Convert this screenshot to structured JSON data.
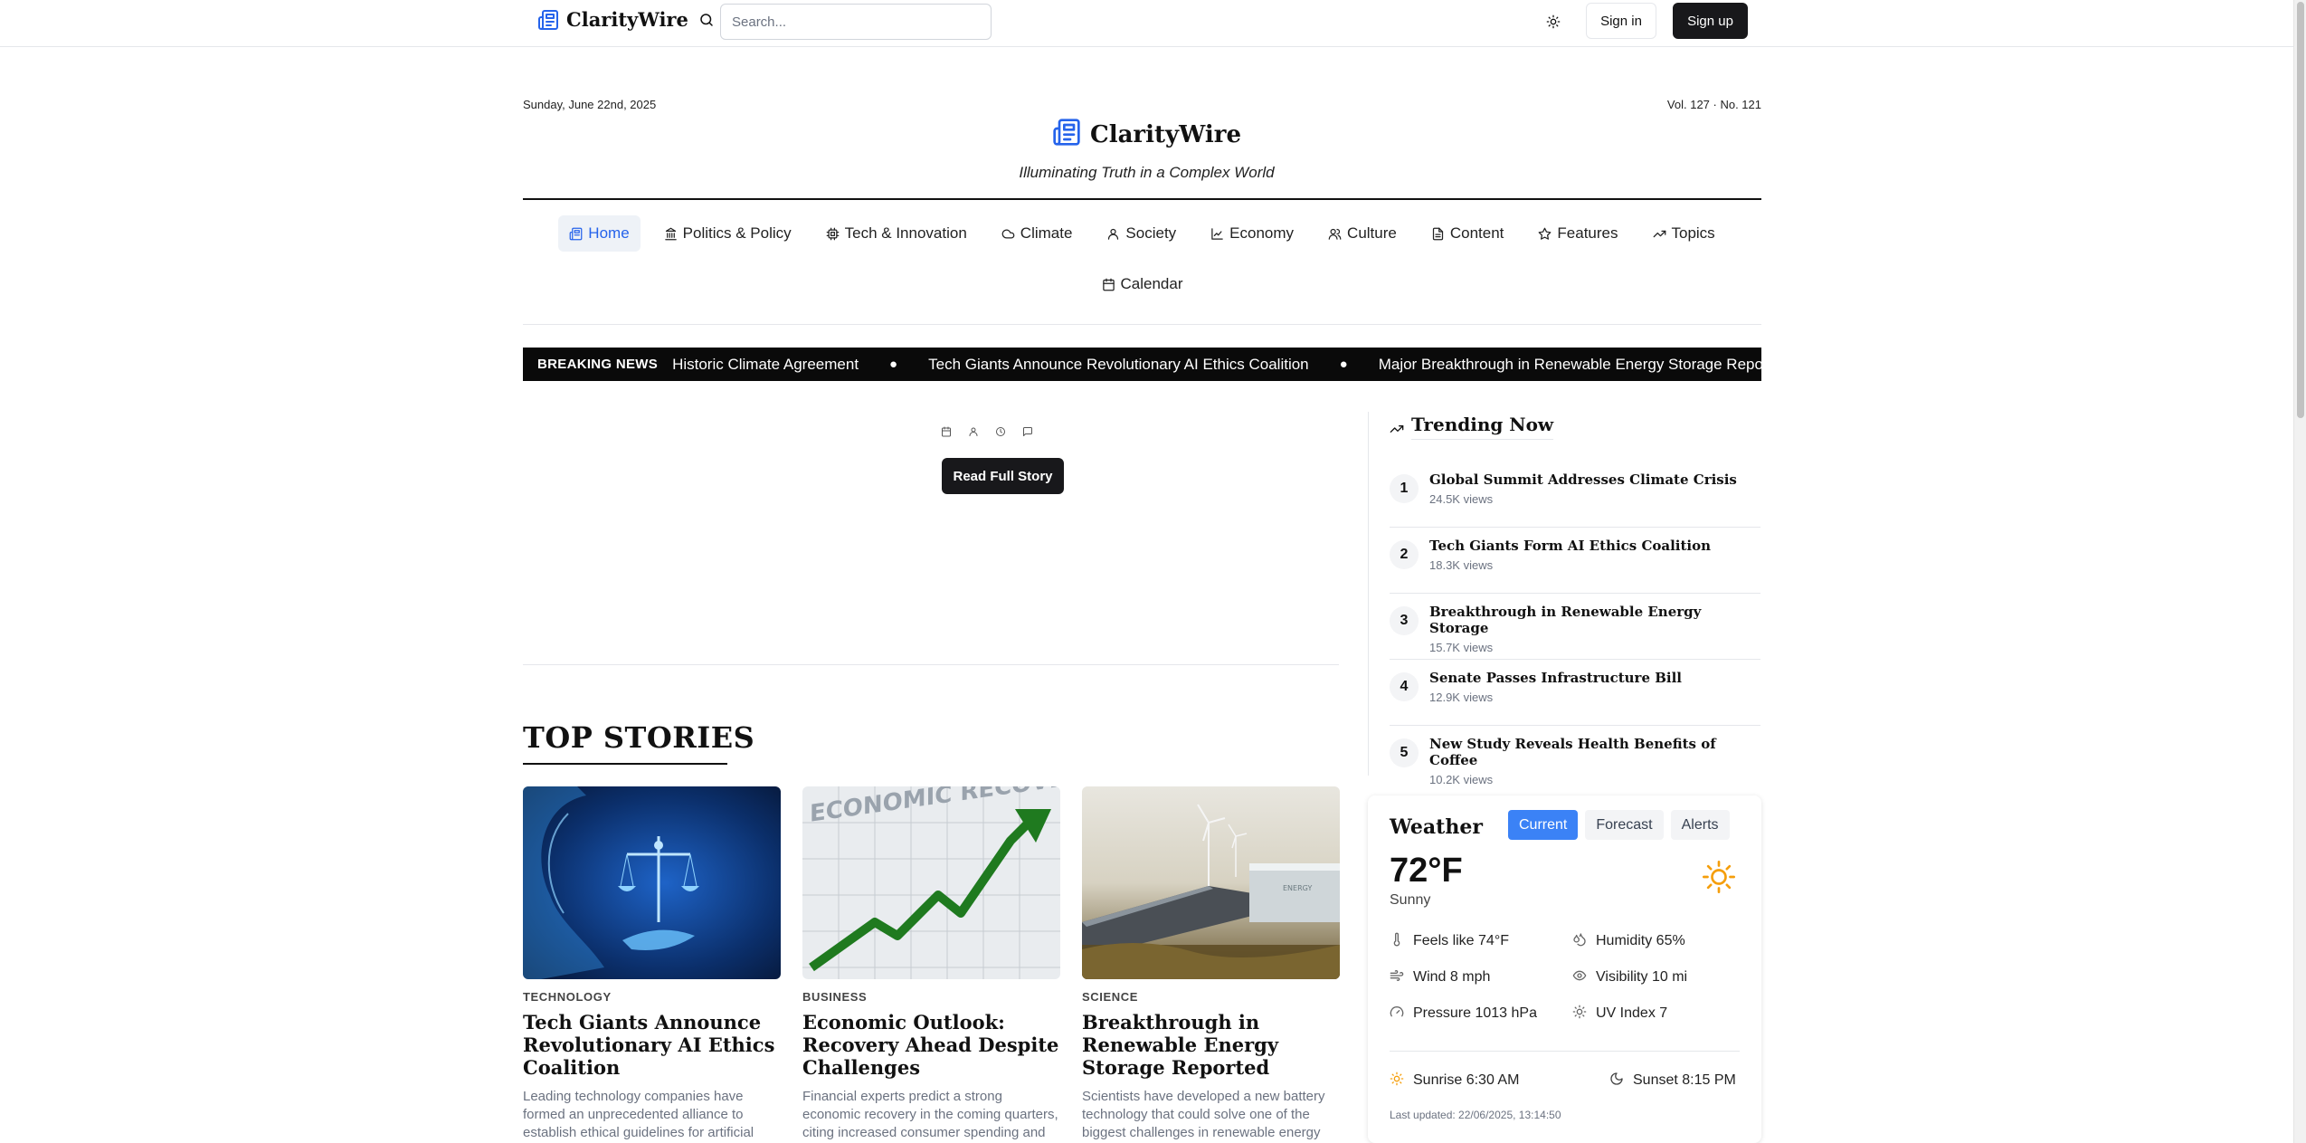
{
  "navbar": {
    "brand": "ClarityWire",
    "search_placeholder": "Search...",
    "theme_icon": "sun-icon",
    "signin_label": "Sign in",
    "signup_label": "Sign up"
  },
  "masthead": {
    "date": "Sunday, June 22nd, 2025",
    "volume": "Vol. 127 · No. 121",
    "title": "ClarityWire",
    "tagline": "Illuminating Truth in a Complex World"
  },
  "sections": [
    {
      "label": "Home",
      "icon": "newspaper-icon"
    },
    {
      "label": "Politics & Policy",
      "icon": "landmark-icon"
    },
    {
      "label": "Tech & Innovation",
      "icon": "cpu-icon"
    },
    {
      "label": "Climate",
      "icon": "cloud-icon"
    },
    {
      "label": "Society",
      "icon": "users-icon"
    },
    {
      "label": "Economy",
      "icon": "chart-line-icon"
    },
    {
      "label": "Culture",
      "icon": "people-icon"
    },
    {
      "label": "Content",
      "icon": "file-icon"
    },
    {
      "label": "Features",
      "icon": "star-icon"
    },
    {
      "label": "Topics",
      "icon": "trending-icon"
    },
    {
      "label": "Calendar",
      "icon": "calendar-icon"
    }
  ],
  "breaking": {
    "label": "BREAKING NEWS",
    "items": [
      "Historic Climate Agreement",
      "Tech Giants Announce Revolutionary AI Ethics Coalition",
      "Major Breakthrough in Renewable Energy Storage Reported"
    ]
  },
  "hero": {
    "read_label": "Read Full Story"
  },
  "top_stories": {
    "title": "TOP STORIES",
    "cards": [
      {
        "category": "TECHNOLOGY",
        "title": "Tech Giants Announce Revolutionary AI Ethics Coalition",
        "excerpt": "Leading technology companies have formed an unprecedented alliance to establish ethical guidelines for artificial"
      },
      {
        "category": "BUSINESS",
        "title": "Economic Outlook: Recovery Ahead Despite Challenges",
        "excerpt": "Financial experts predict a strong economic recovery in the coming quarters, citing increased consumer spending and",
        "image_text": "ECONOMIC RECOVERY"
      },
      {
        "category": "SCIENCE",
        "title": "Breakthrough in Renewable Energy Storage Reported",
        "excerpt": "Scientists have developed a new battery technology that could solve one of the biggest challenges in renewable energy",
        "image_text": "ENERGY"
      }
    ]
  },
  "trending": {
    "title": "Trending Now",
    "items": [
      {
        "rank": "1",
        "title": "Global Summit Addresses Climate Crisis",
        "views": "24.5K views"
      },
      {
        "rank": "2",
        "title": "Tech Giants Form AI Ethics Coalition",
        "views": "18.3K views"
      },
      {
        "rank": "3",
        "title": "Breakthrough in Renewable Energy Storage",
        "views": "15.7K views"
      },
      {
        "rank": "4",
        "title": "Senate Passes Infrastructure Bill",
        "views": "12.9K views"
      },
      {
        "rank": "5",
        "title": "New Study Reveals Health Benefits of Coffee",
        "views": "10.2K views"
      }
    ]
  },
  "weather": {
    "title": "Weather",
    "tabs": [
      "Current",
      "Forecast",
      "Alerts"
    ],
    "active_tab": "Current",
    "temperature": "72°F",
    "condition": "Sunny",
    "feels_like": "Feels like 74°F",
    "humidity": "Humidity 65%",
    "wind": "Wind 8 mph",
    "visibility": "Visibility 10 mi",
    "pressure": "Pressure 1013 hPa",
    "uv": "UV Index 7",
    "sunrise": "Sunrise 6:30 AM",
    "sunset": "Sunset 8:15 PM",
    "updated": "Last updated: 22/06/2025, 13:14:50",
    "sun_color": "#f59e0b"
  },
  "colors": {
    "accent": "#2563eb",
    "dark_button": "#18181b",
    "tab_active": "#3b82f6"
  }
}
